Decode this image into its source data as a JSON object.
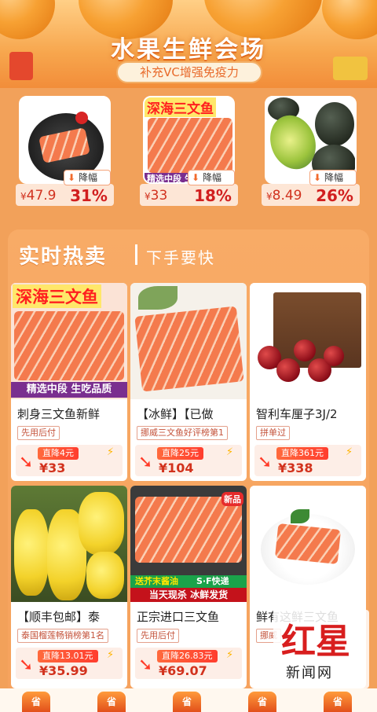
{
  "banner": {
    "title": "水果生鲜会场",
    "subtitle": "补充VC增强免疫力"
  },
  "deals": [
    {
      "price_symbol": "¥",
      "price": "47.9",
      "drop_label": "降幅",
      "pct": "31%"
    },
    {
      "price_symbol": "¥",
      "price": "33",
      "drop_label": "降幅",
      "pct": "18%",
      "img_title": "深海三文鱼",
      "img_band": "精选中段 生"
    },
    {
      "price_symbol": "¥",
      "price": "8.49",
      "drop_label": "降幅",
      "pct": "26%"
    }
  ],
  "hot": {
    "title": "实时热卖",
    "subtitle": "下手要快"
  },
  "products": [
    {
      "name": "刺身三文鱼新鲜",
      "tag": "先用后付",
      "cut": "直降4元",
      "price": "¥33",
      "img_title": "深海三文鱼",
      "img_band": "精选中段 生吃品质"
    },
    {
      "name": "【冰鲜】【已做",
      "tag": "挪威三文鱼好评榜第1",
      "cut": "直降25元",
      "price": "¥104"
    },
    {
      "name": "智利车厘子3J/2",
      "tag": "拼单过",
      "cut": "直降361元",
      "price": "¥338"
    },
    {
      "name": "【顺丰包邮】泰",
      "tag": "泰国榴莲畅销榜第1名",
      "cut": "直降13.01元",
      "price": "¥35.99"
    },
    {
      "name": "正宗进口三文鱼",
      "tag": "先用后付",
      "cut": "直降26.83元",
      "price": "¥69.07",
      "img_band1": "送芥末酱油",
      "img_band1b": "S·F快递",
      "img_band2": "当天现杀 冰鲜发货",
      "img_badge": "新品"
    },
    {
      "name": "鲜有这鲜三文鱼",
      "tag": "挪威",
      "cut": "",
      "price": ""
    }
  ],
  "tabs": [
    "省",
    "省",
    "省",
    "省",
    "省"
  ],
  "watermark": {
    "big": "红星",
    "small": "新闻网"
  },
  "colors": {
    "accent": "#f2a15a",
    "price_red": "#d2321d"
  }
}
